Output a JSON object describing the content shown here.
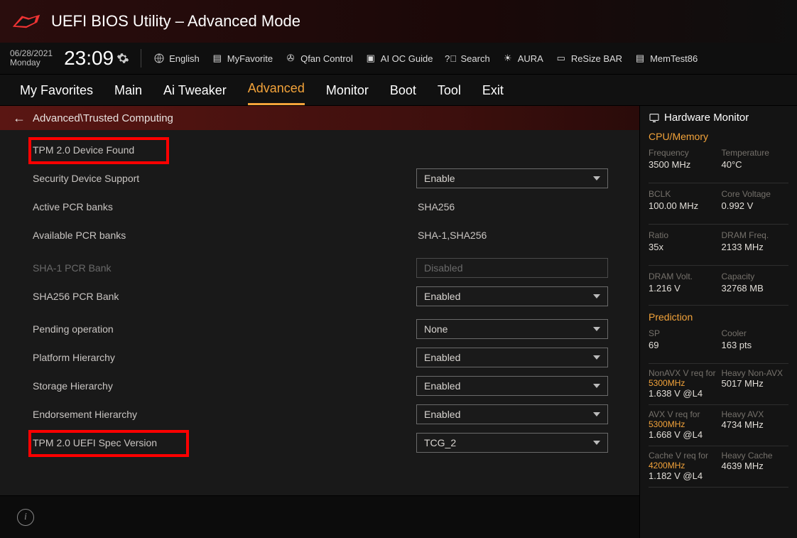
{
  "header": {
    "title": "UEFI BIOS Utility – Advanced Mode"
  },
  "datetime": {
    "date": "06/28/2021",
    "day": "Monday",
    "time": "23:09"
  },
  "toolbar": {
    "language": "English",
    "items": [
      "MyFavorite",
      "Qfan Control",
      "AI OC Guide",
      "Search",
      "AURA",
      "ReSize BAR",
      "MemTest86"
    ]
  },
  "tabs": [
    "My Favorites",
    "Main",
    "Ai Tweaker",
    "Advanced",
    "Monitor",
    "Boot",
    "Tool",
    "Exit"
  ],
  "activeTab": "Advanced",
  "breadcrumb": "Advanced\\Trusted Computing",
  "settings": {
    "tpm_found": "TPM 2.0 Device Found",
    "rows": [
      {
        "label": "Security Device Support",
        "type": "select",
        "value": "Enable"
      },
      {
        "label": "Active PCR banks",
        "type": "text",
        "value": "SHA256"
      },
      {
        "label": "Available PCR banks",
        "type": "text",
        "value": "SHA-1,SHA256"
      },
      {
        "label": "SHA-1 PCR Bank",
        "type": "disabled",
        "value": "Disabled"
      },
      {
        "label": "SHA256 PCR Bank",
        "type": "select",
        "value": "Enabled"
      },
      {
        "label": "Pending operation",
        "type": "select",
        "value": "None"
      },
      {
        "label": "Platform Hierarchy",
        "type": "select",
        "value": "Enabled"
      },
      {
        "label": "Storage Hierarchy",
        "type": "select",
        "value": "Enabled"
      },
      {
        "label": "Endorsement Hierarchy",
        "type": "select",
        "value": "Enabled"
      },
      {
        "label": "TPM 2.0 UEFI Spec Version",
        "type": "select",
        "value": "TCG_2"
      }
    ]
  },
  "hwmon": {
    "title": "Hardware Monitor",
    "cpu_section": "CPU/Memory",
    "cpu": [
      {
        "l": "Frequency",
        "v": "3500 MHz"
      },
      {
        "l": "Temperature",
        "v": "40°C"
      },
      {
        "l": "BCLK",
        "v": "100.00 MHz"
      },
      {
        "l": "Core Voltage",
        "v": "0.992 V"
      },
      {
        "l": "Ratio",
        "v": "35x"
      },
      {
        "l": "DRAM Freq.",
        "v": "2133 MHz"
      },
      {
        "l": "DRAM Volt.",
        "v": "1.216 V"
      },
      {
        "l": "Capacity",
        "v": "32768 MB"
      }
    ],
    "pred_section": "Prediction",
    "sp": {
      "l": "SP",
      "v": "69"
    },
    "cooler": {
      "l": "Cooler",
      "v": "163 pts"
    },
    "pred": [
      {
        "a": "NonAVX V req for ",
        "f": "5300MHz",
        "v": "1.638 V @L4",
        "rl": "Heavy Non-AVX",
        "rv": "5017 MHz"
      },
      {
        "a": "AVX V req for ",
        "f": "5300MHz",
        "v": "1.668 V @L4",
        "rl": "Heavy AVX",
        "rv": "4734 MHz"
      },
      {
        "a": "Cache V req for ",
        "f": "4200MHz",
        "v": "1.182 V @L4",
        "rl": "Heavy Cache",
        "rv": "4639 MHz"
      }
    ]
  }
}
